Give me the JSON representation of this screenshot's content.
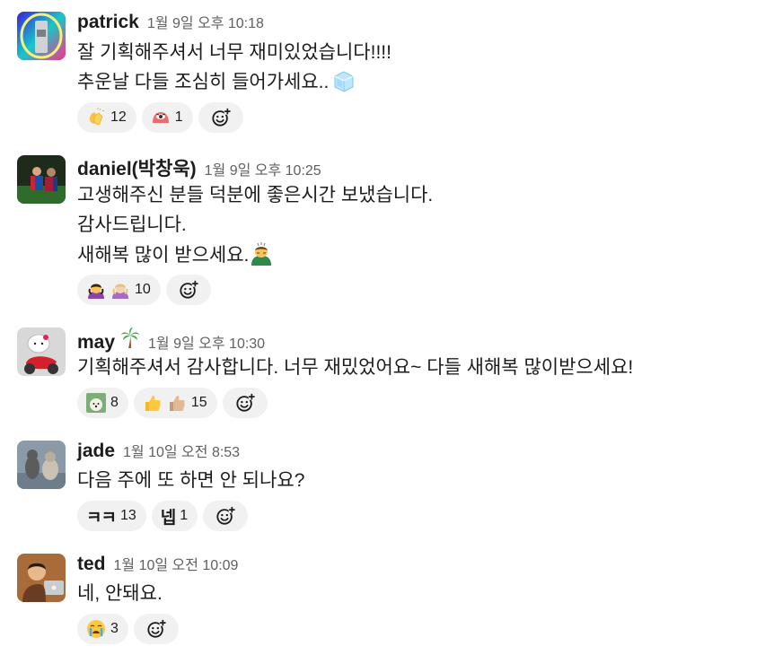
{
  "messages": [
    {
      "user": "patrick",
      "time": "1월 9일 오후 10:18",
      "lines": [
        "잘 기획해주셔서 너무 재미있었습니다!!!!",
        "추운날 다들 조심히 들어가세요.."
      ],
      "inline_emoji": "ice-cube-icon",
      "reactions": [
        {
          "emoji": "clapping-hands-icon",
          "count": "12"
        },
        {
          "emoji": "red-eye-blob-icon",
          "count": "1"
        }
      ]
    },
    {
      "user": "daniel(박창욱)",
      "time": "1월 9일 오후 10:25",
      "lines": [
        "고생해주신 분들 덕분에 좋은시간 보냈습니다.",
        "감사드립니다.",
        "새해복 많이 받으세요."
      ],
      "inline_emoji": "man-bowing-icon",
      "reactions": [
        {
          "emoji": "woman-bowing-icon",
          "emoji2": "woman-bowing-light-icon",
          "count": "10"
        }
      ]
    },
    {
      "user": "may",
      "user_emoji": "palm-tree-icon",
      "time": "1월 9일 오후 10:30",
      "lines": [
        "기획해주셔서 감사합니다. 너무 재밌었어요~ 다들 새해복 많이받으세요!"
      ],
      "reactions": [
        {
          "emoji": "custom-dog-icon",
          "count": "8"
        },
        {
          "emoji": "thumbs-up-icon",
          "emoji2": "thumbs-up-light-icon",
          "count": "15"
        }
      ]
    },
    {
      "user": "jade",
      "time": "1월 10일 오전 8:53",
      "lines": [
        "다음 주에 또 하면 안 되나요?"
      ],
      "reactions": [
        {
          "label": "ㅋㅋ",
          "count": "13"
        },
        {
          "label": "넵",
          "count": "1"
        }
      ]
    },
    {
      "user": "ted",
      "time": "1월 10일 오전 10:09",
      "lines": [
        "네, 안돼요."
      ],
      "reactions": [
        {
          "emoji": "crying-face-icon",
          "count": "3"
        }
      ]
    }
  ],
  "colors": {
    "pill_bg": "#f1f1f1",
    "name": "#1d1c1d",
    "time": "#616061"
  }
}
